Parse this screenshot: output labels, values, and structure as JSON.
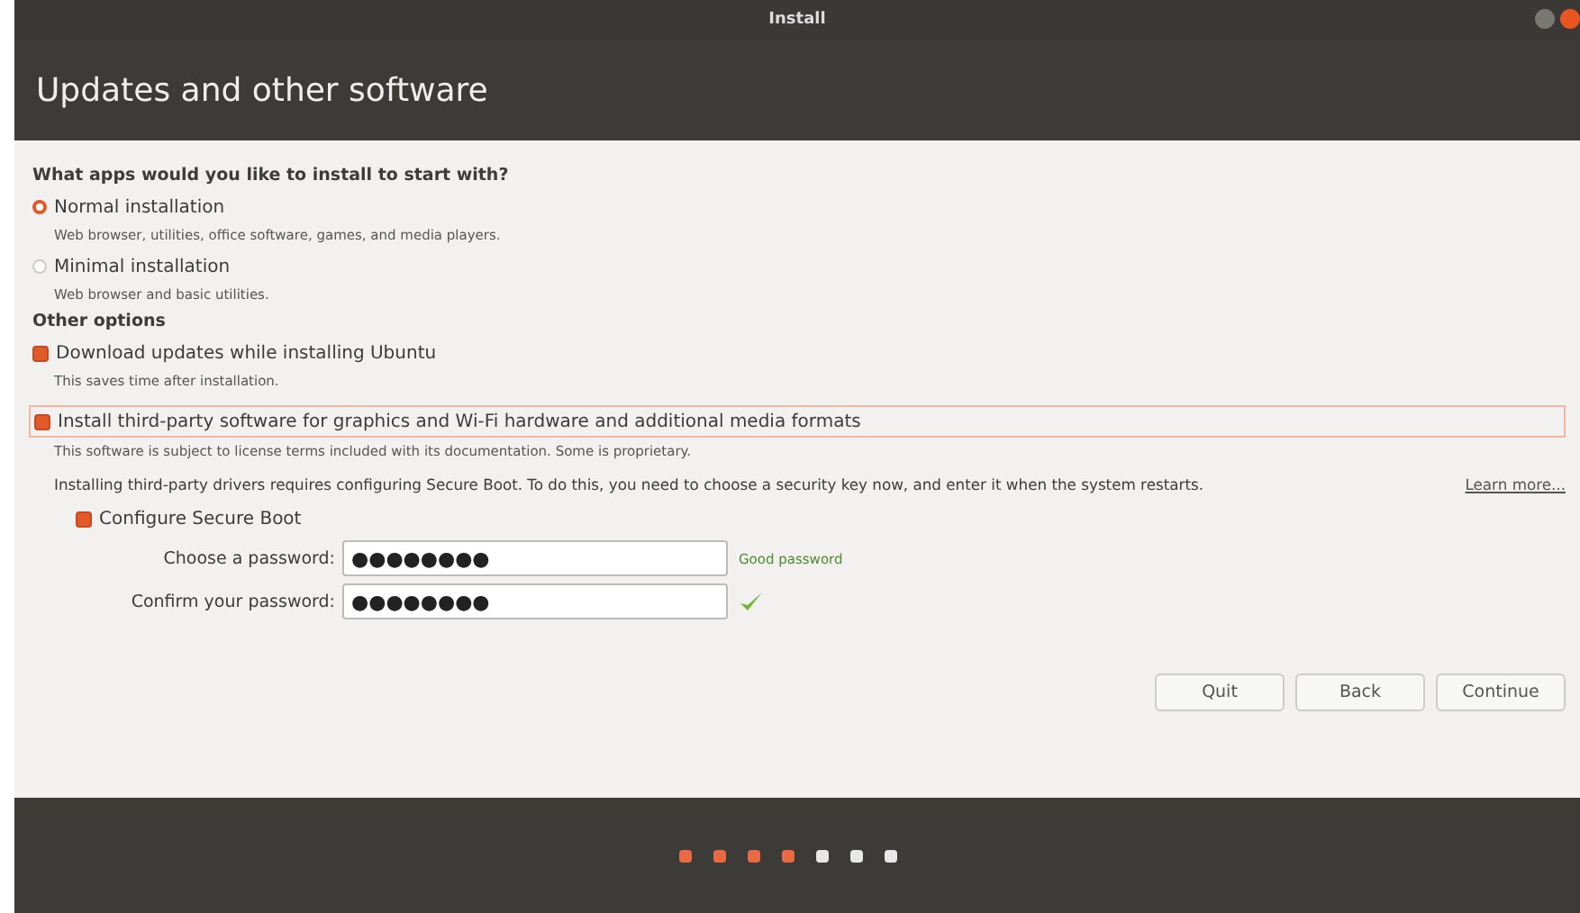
{
  "window": {
    "title": "Install"
  },
  "header": {
    "title": "Updates and other software"
  },
  "apps_section": {
    "heading": "What apps would you like to install to start with?",
    "options": [
      {
        "label": "Normal installation",
        "description": "Web browser, utilities, office software, games, and media players.",
        "selected": true
      },
      {
        "label": "Minimal installation",
        "description": "Web browser and basic utilities.",
        "selected": false
      }
    ]
  },
  "other_options": {
    "heading": "Other options",
    "download_updates": {
      "label": "Download updates while installing Ubuntu",
      "description": "This saves time after installation.",
      "checked": true
    },
    "third_party": {
      "label": "Install third-party software for graphics and Wi-Fi hardware and additional media formats",
      "description": "This software is subject to license terms included with its documentation. Some is proprietary.",
      "checked": true,
      "focused": true
    },
    "secure_boot_note": "Installing third-party drivers requires configuring Secure Boot. To do this, you need to choose a security key now, and enter it when the system restarts.",
    "learn_more": "Learn more...",
    "secure_boot": {
      "label": "Configure Secure Boot",
      "checked": true
    },
    "password": {
      "label": "Choose a password:",
      "value": "●●●●●●●●",
      "strength": "Good password"
    },
    "confirm": {
      "label": "Confirm your password:",
      "value": "●●●●●●●●",
      "match": true
    }
  },
  "buttons": [
    "Quit",
    "Back",
    "Continue"
  ],
  "progress": [
    {
      "done": true
    },
    {
      "done": true
    },
    {
      "done": true
    },
    {
      "done": true
    },
    {
      "done": false
    },
    {
      "done": false
    },
    {
      "done": false
    }
  ]
}
